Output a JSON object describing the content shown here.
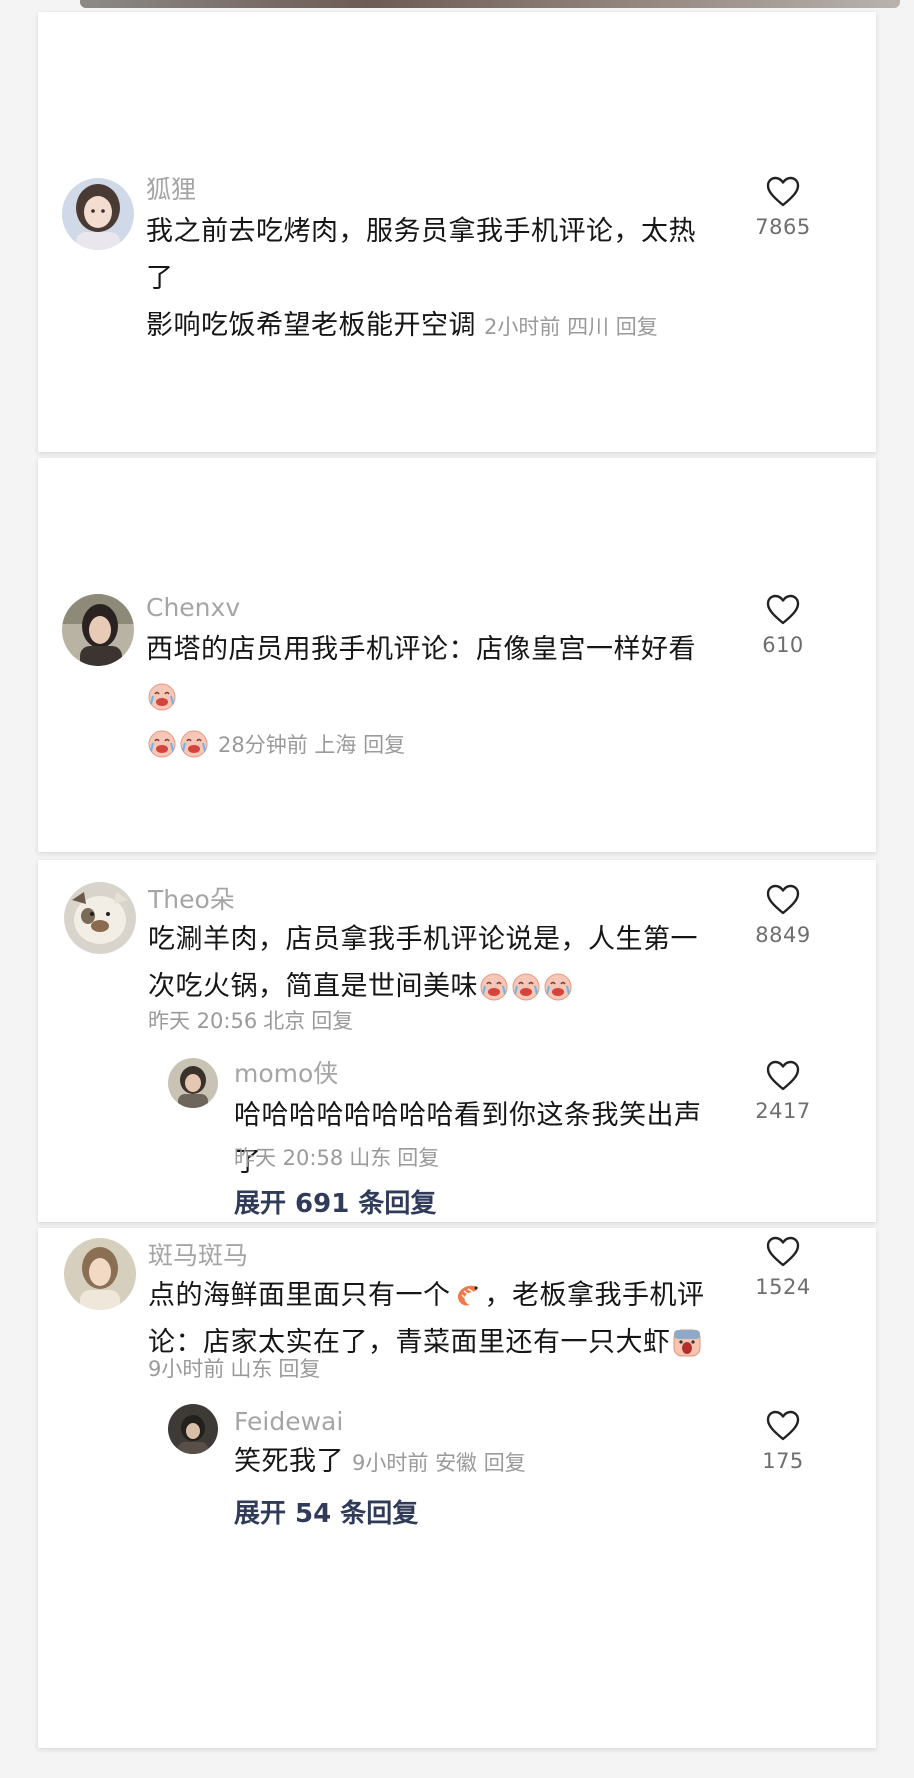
{
  "comments": [
    {
      "user": "狐狸",
      "text": "我之前去吃烤肉，服务员拿我手机评论，太热了影响吃饭希望老板能开空调",
      "text_line1": "我之前去吃烤肉，服务员拿我手机评论，太热了",
      "text_line2": "影响吃饭希望老板能开空调",
      "time": "2小时前",
      "location": "四川",
      "reply_label": "回复",
      "likes": "7865",
      "avatar_icon": "girl-avatar"
    },
    {
      "user": "Chenxv",
      "text_line1": "西塔的店员用我手机评论：店像皇宫一样好看",
      "time": "28分钟前",
      "location": "上海",
      "reply_label": "回复",
      "likes": "610",
      "emoji_icon": "crying-laugh-emoji"
    },
    {
      "user": "Theo朵",
      "text_line1": "吃涮羊肉，店员拿我手机评论说是，人生第一",
      "text_line2": "次吃火锅，简直是世间美味",
      "time": "昨天 20:56",
      "location": "北京",
      "reply_label": "回复",
      "likes": "8849",
      "avatar_icon": "bulldog-avatar",
      "reply": {
        "user": "momo侠",
        "text": "哈哈哈哈哈哈哈哈看到你这条我笑出声了",
        "time": "昨天 20:58",
        "location": "山东",
        "reply_label": "回复",
        "likes": "2417"
      },
      "expand_label": "展开 691 条回复"
    },
    {
      "user": "斑马斑马",
      "text_line1_a": "点的海鲜面里面只有一个",
      "text_line1_b": "，老板拿我手机评",
      "text_line2": "论：店家太实在了，青菜面里还有一只大虾",
      "time": "9小时前",
      "location": "山东",
      "reply_label": "回复",
      "likes": "1524",
      "emoji_icons": [
        "shrimp-emoji",
        "shocked-emoji"
      ],
      "reply": {
        "user": "Feidewai",
        "text": "笑死我了",
        "time": "9小时前",
        "location": "安徽",
        "reply_label": "回复",
        "likes": "175"
      },
      "expand_label": "展开 54 条回复"
    }
  ],
  "colors": {
    "username": "#a5a5a5",
    "body": "#161616",
    "meta": "#9a9a9a",
    "expand": "#2f3b58",
    "heart": "#222222"
  }
}
